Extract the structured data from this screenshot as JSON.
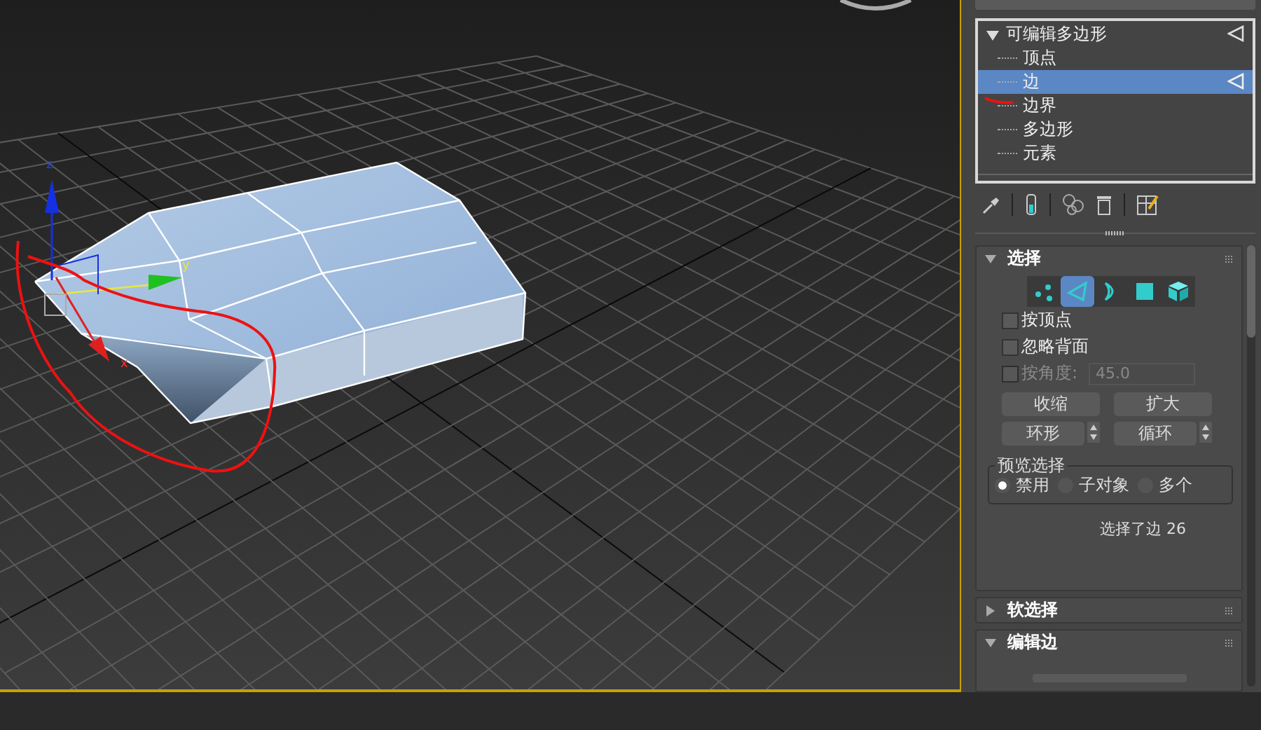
{
  "viewport": {
    "axis_labels": [
      {
        "kind": "z",
        "text": "z"
      },
      {
        "kind": "y",
        "text": "y"
      },
      {
        "kind": "x",
        "text": "x"
      }
    ]
  },
  "modifier_stack": {
    "label": "可编辑多边形",
    "expanded": true,
    "children": [
      {
        "label": "顶点",
        "selected": false
      },
      {
        "label": "边",
        "selected": true
      },
      {
        "label": "边界",
        "selected": false
      },
      {
        "label": "多边形",
        "selected": false
      },
      {
        "label": "元素",
        "selected": false
      }
    ]
  },
  "rollouts": [
    {
      "title": "选择",
      "expanded": true,
      "modes": [
        {
          "kind": "vertex",
          "selected": false
        },
        {
          "kind": "edge",
          "selected": true
        },
        {
          "kind": "border",
          "selected": false
        },
        {
          "kind": "polygon",
          "selected": false
        },
        {
          "kind": "element",
          "selected": false
        }
      ],
      "checkboxes": [
        {
          "label": "按顶点",
          "checked": false,
          "disabled": false
        },
        {
          "label": "忽略背面",
          "checked": false,
          "disabled": false
        },
        {
          "label": "按角度:",
          "checked": false,
          "disabled": true,
          "value": "45.0"
        }
      ],
      "button_rows": [
        [
          {
            "label": "收缩",
            "spinner": false
          },
          {
            "label": "扩大",
            "spinner": false
          }
        ],
        [
          {
            "label": "环形",
            "spinner": true
          },
          {
            "label": "循环",
            "spinner": true
          }
        ]
      ],
      "preview": {
        "title": "预览选择",
        "options": [
          {
            "label": "禁用",
            "selected": true
          },
          {
            "label": "子对象",
            "selected": false
          },
          {
            "label": "多个",
            "selected": false
          }
        ]
      },
      "status": "选择了边 26"
    },
    {
      "title": "软选择",
      "expanded": false
    },
    {
      "title": "编辑边",
      "expanded": true
    }
  ]
}
